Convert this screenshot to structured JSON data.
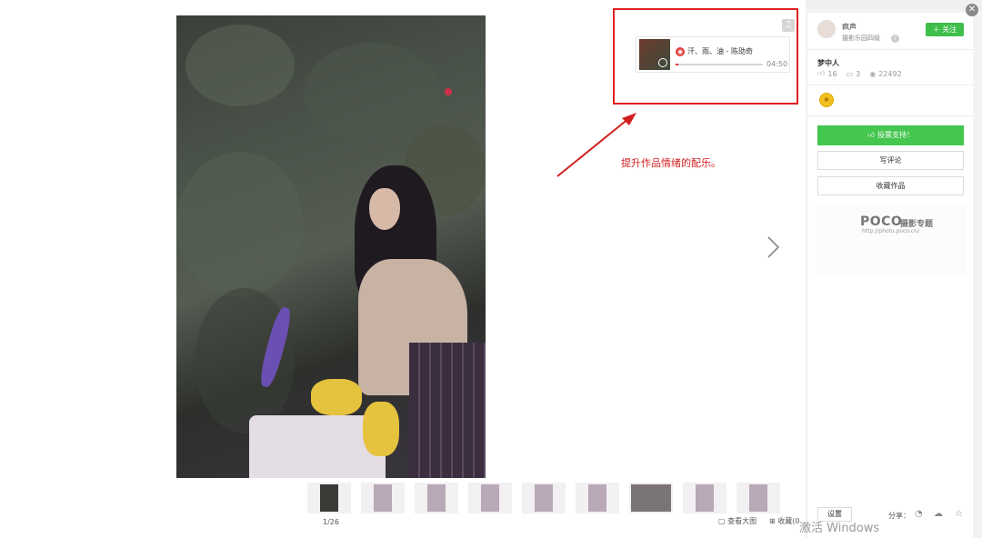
{
  "annotation": {
    "text": "提升作品情绪的配乐。"
  },
  "player": {
    "song_title": "汗、雨、油 - 陈劭奇",
    "duration": "04:50",
    "progress_fraction": 0.03
  },
  "viewer": {
    "counter": "1/26",
    "view_large_label": "查看大图",
    "collect_label": "收藏(0",
    "thumbnails": 10
  },
  "author": {
    "name": "疯声",
    "level": "摄影乐园四级",
    "follow_label": "关注"
  },
  "work": {
    "title": "梦中人",
    "likes": "16",
    "comments": "3",
    "views": "22492"
  },
  "actions": {
    "support_label": "投票支持！",
    "comment_label": "写评论",
    "favorite_label": "收藏作品"
  },
  "promo": {
    "brand": "POCO",
    "subtitle": "摄影专题",
    "url": "http://photo.poco.cn/"
  },
  "footer": {
    "settings_label": "设置",
    "share_label": "分享："
  },
  "os_watermark": {
    "line1": "激活 Windows"
  },
  "colors": {
    "accent_green": "#44c64f",
    "highlight_red": "#e02020"
  },
  "icons": {
    "music": "music-note-icon",
    "close": "close-icon",
    "next": "chevron-right-icon"
  }
}
